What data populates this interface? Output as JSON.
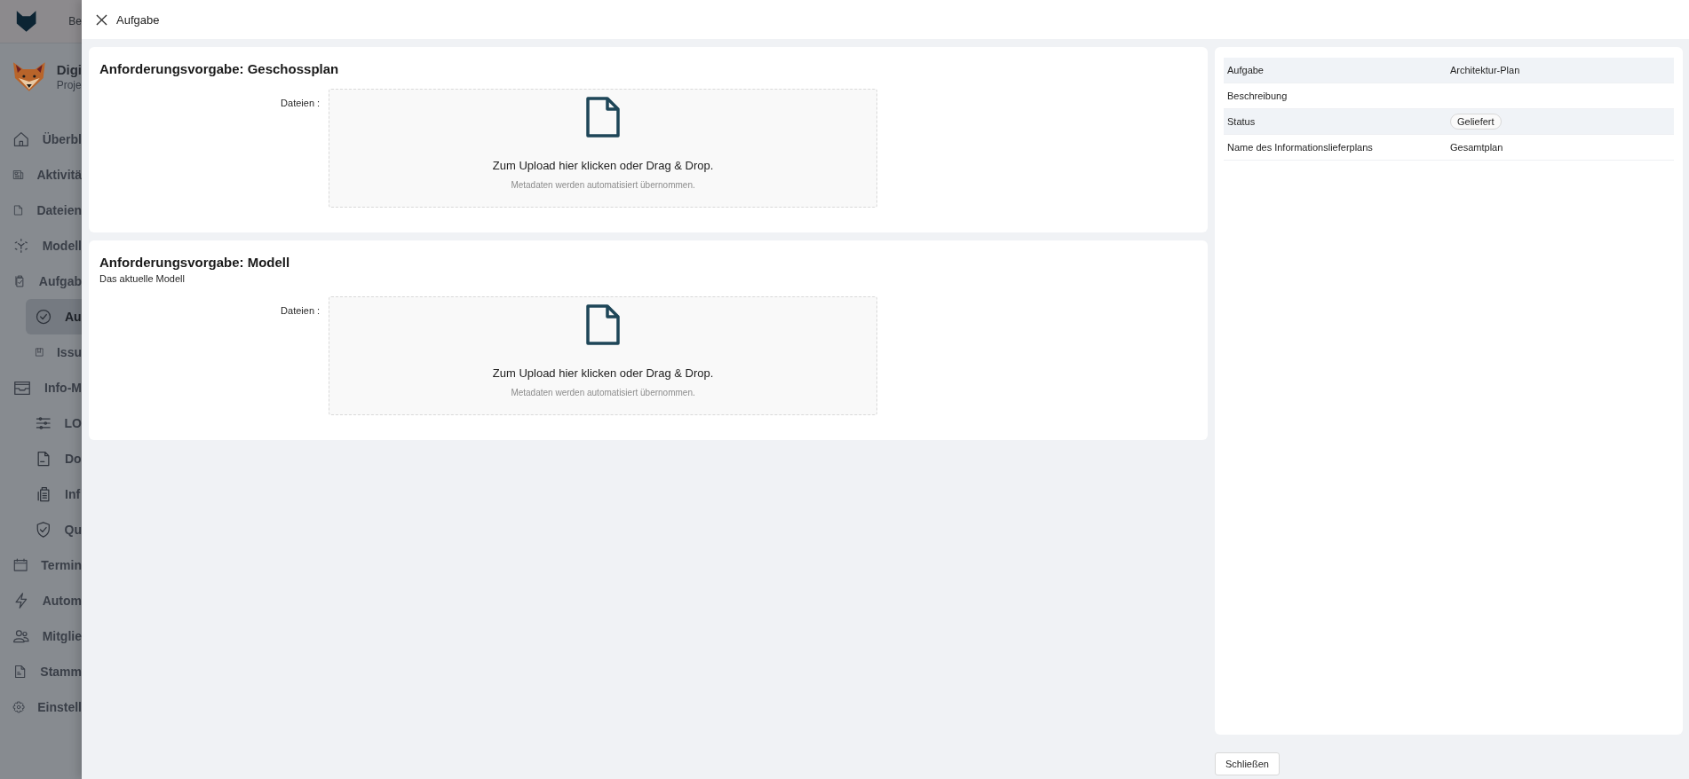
{
  "sidebar": {
    "brand_text": "Be",
    "project": {
      "name": "Digi",
      "subtitle": "Proje"
    },
    "items": [
      {
        "label": "Überbl",
        "selected": false
      },
      {
        "label": "Aktivitä",
        "selected": false
      },
      {
        "label": "Dateien",
        "selected": false
      },
      {
        "label": "Modell",
        "selected": false
      },
      {
        "label": "Aufgab",
        "selected": false,
        "children": [
          {
            "label": "Au",
            "selected": true
          },
          {
            "label": "Issu",
            "selected": false
          }
        ]
      },
      {
        "label": "Info-M",
        "selected": false,
        "children": [
          {
            "label": "LO",
            "selected": false
          },
          {
            "label": "Do",
            "selected": false
          },
          {
            "label": "Inf",
            "selected": false
          },
          {
            "label": "Qu",
            "selected": false
          }
        ]
      },
      {
        "label": "Termin",
        "selected": false
      },
      {
        "label": "Autom",
        "selected": false
      },
      {
        "label": "Mitglie",
        "selected": false
      },
      {
        "label": "Stamm",
        "selected": false
      },
      {
        "label": "Einstell",
        "selected": false
      }
    ]
  },
  "drawer": {
    "title": "Aufgabe",
    "sections": [
      {
        "title": "Anforderungsvorgabe: Geschossplan",
        "field_label": "Dateien",
        "field_separator": ":",
        "upload_text": "Zum Upload hier klicken oder Drag & Drop.",
        "upload_hint": "Metadaten werden automatisiert übernommen."
      },
      {
        "title": "Anforderungsvorgabe: Modell",
        "description": "Das aktuelle Modell",
        "field_label": "Dateien",
        "field_separator": ":",
        "upload_text": "Zum Upload hier klicken oder Drag & Drop.",
        "upload_hint": "Metadaten werden automatisiert übernommen."
      }
    ],
    "details": [
      {
        "label": "Aufgabe",
        "value": "Architektur-Plan",
        "kind": "text"
      },
      {
        "label": "Beschreibung"
      },
      {
        "label": "Status",
        "value": "Geliefert",
        "kind": "badge"
      },
      {
        "label": "Name des Informationslieferplans",
        "value": "Gesamtplan",
        "kind": "text"
      }
    ],
    "close_button": "Schließen"
  }
}
